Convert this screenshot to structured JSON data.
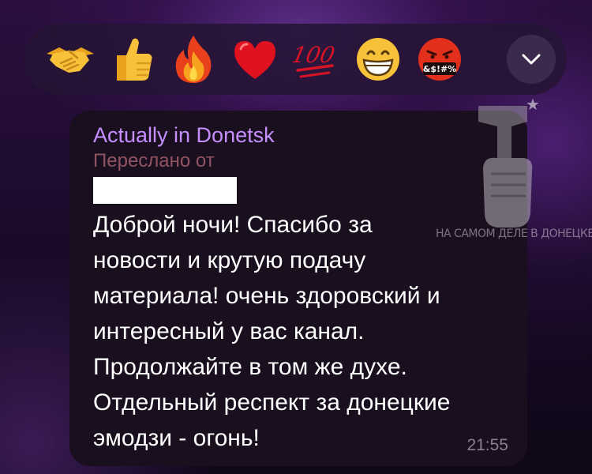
{
  "reactions": [
    {
      "name": "handshake"
    },
    {
      "name": "thumbs-up"
    },
    {
      "name": "fire"
    },
    {
      "name": "red-heart"
    },
    {
      "name": "hundred-points"
    },
    {
      "name": "grinning-face"
    },
    {
      "name": "face-with-symbols"
    }
  ],
  "reaction_symbols_text": "&$!#%",
  "hundred_text": "100",
  "expand_icon": "chevron-down-icon",
  "message": {
    "sender": "Actually in Donetsk",
    "forwarded_label": "Переслано от",
    "lines": [
      "Доброй ночи! Спасибо за",
      "новости и крутую подачу",
      "материала! очень здоровский и",
      "интересный у вас канал.",
      "Продолжайте в том же духе.",
      "Отдельный респект за донецкие",
      "эмодзи - огонь!"
    ],
    "time": "21:55"
  },
  "watermark": {
    "text": "НА САМОМ ДЕЛЕ В ДОНЕЦКЕ"
  },
  "colors": {
    "sender": "#c58fff",
    "forwarded": "#a05b6a",
    "bubble": "#1a0f1e",
    "bar": "#26143a"
  }
}
